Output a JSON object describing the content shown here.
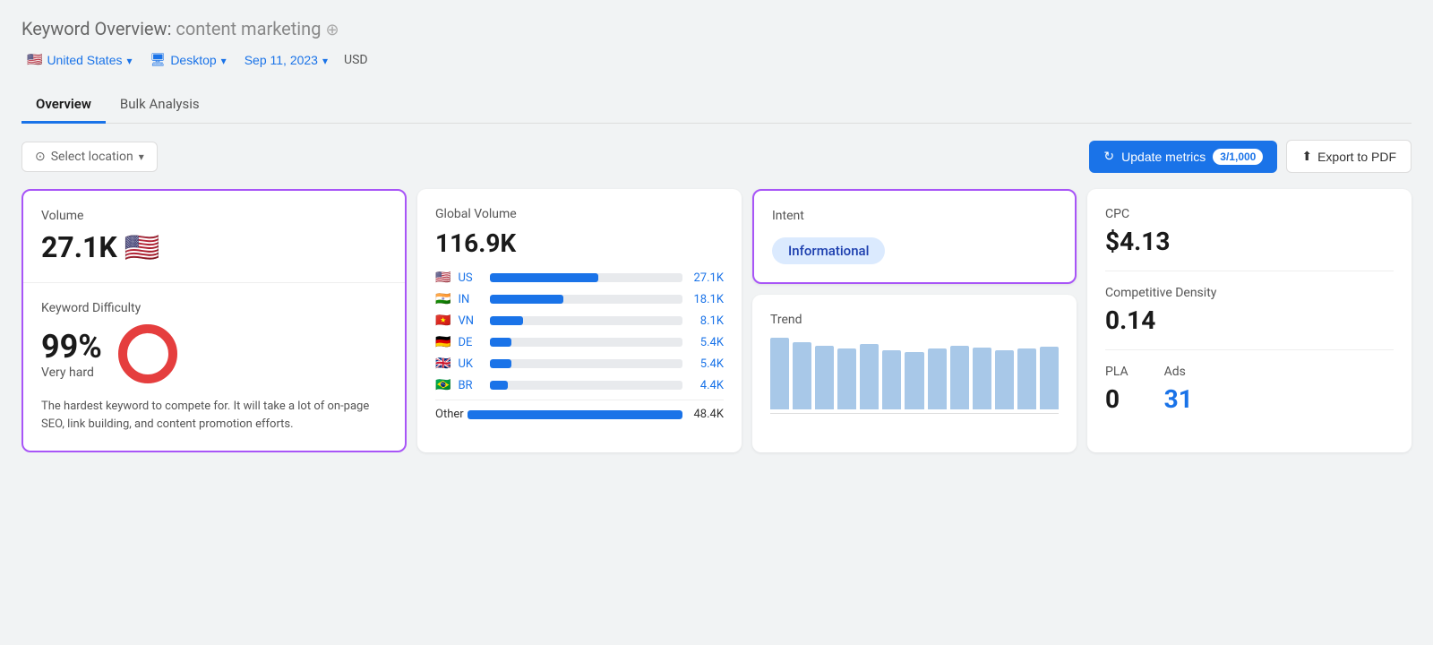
{
  "header": {
    "title_prefix": "Keyword Overview:",
    "keyword": "content marketing",
    "plus_icon": "⊕"
  },
  "top_bar": {
    "country": "United States",
    "country_flag": "🇺🇸",
    "device": "Desktop",
    "device_icon": "🖥",
    "date": "Sep 11, 2023",
    "currency": "USD"
  },
  "tabs": [
    {
      "label": "Overview",
      "active": true
    },
    {
      "label": "Bulk Analysis",
      "active": false
    }
  ],
  "toolbar": {
    "location_placeholder": "Select location",
    "update_metrics_label": "Update metrics",
    "update_metrics_counter": "3/1,000",
    "export_label": "Export to PDF"
  },
  "volume_card": {
    "label": "Volume",
    "value": "27.1K",
    "flag": "🇺🇸"
  },
  "kd_card": {
    "label": "Keyword Difficulty",
    "percent": "99%",
    "difficulty_label": "Very hard",
    "description": "The hardest keyword to compete for. It will take a lot of on-page SEO, link building, and content promotion efforts.",
    "donut_filled": 99,
    "donut_color": "#e53e3e",
    "donut_bg": "#f0f0f0"
  },
  "global_volume": {
    "label": "Global Volume",
    "value": "116.9K",
    "countries": [
      {
        "flag": "🇺🇸",
        "code": "US",
        "value": "27.1K",
        "pct": 56
      },
      {
        "flag": "🇮🇳",
        "code": "IN",
        "value": "18.1K",
        "pct": 38
      },
      {
        "flag": "🇻🇳",
        "code": "VN",
        "value": "8.1K",
        "pct": 17
      },
      {
        "flag": "🇩🇪",
        "code": "DE",
        "value": "5.4K",
        "pct": 11
      },
      {
        "flag": "🇬🇧",
        "code": "UK",
        "value": "5.4K",
        "pct": 11
      },
      {
        "flag": "🇧🇷",
        "code": "BR",
        "value": "4.4K",
        "pct": 9
      }
    ],
    "other_label": "Other",
    "other_value": "48.4K",
    "other_pct": 100
  },
  "intent_card": {
    "label": "Intent",
    "value": "Informational"
  },
  "trend_card": {
    "label": "Trend",
    "bars": [
      85,
      80,
      75,
      72,
      78,
      70,
      68,
      72,
      75,
      73,
      70,
      72,
      74
    ]
  },
  "metrics": {
    "cpc_label": "CPC",
    "cpc_value": "$4.13",
    "comp_density_label": "Competitive Density",
    "comp_density_value": "0.14",
    "pla_label": "PLA",
    "pla_value": "0",
    "ads_label": "Ads",
    "ads_value": "31"
  }
}
